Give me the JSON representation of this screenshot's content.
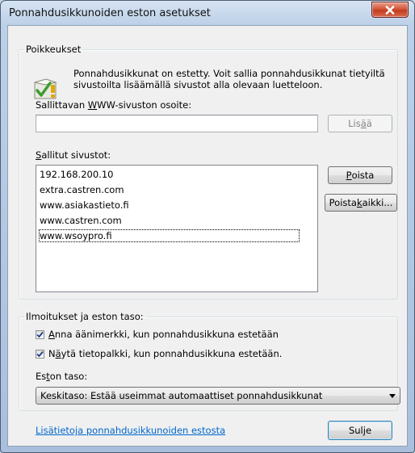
{
  "window": {
    "title": "Ponnahdusikkunoiden eston asetukset"
  },
  "exceptions": {
    "legend": "Poikkeukset",
    "info_line1": "Ponnahdusikkunat on estetty. Voit sallia ponnahdusikkunat tietyiltä",
    "info_line2": "sivustoilta lisäämällä sivustot alla olevaan luetteloon.",
    "address_label_pre": "Sallittavan ",
    "address_label_key": "W",
    "address_label_post": "WW-sivuston osoite:",
    "address_value": "",
    "add_label_pre": "Lis",
    "add_label_key": "ä",
    "add_label_post": "ä",
    "allowed_label_pre": "",
    "allowed_label_key": "S",
    "allowed_label_post": "allitut sivustot:",
    "allowed_sites": [
      "192.168.200.10",
      "extra.castren.com",
      "www.asiakastieto.fi",
      "www.castren.com",
      "www.wsoypro.fi"
    ],
    "remove_label_key": "P",
    "remove_label_post": "oista",
    "remove_all_label_pre": "Poista ",
    "remove_all_label_key": "k",
    "remove_all_label_post": "aikki..."
  },
  "notifications": {
    "legend": "Ilmoitukset ja eston taso:",
    "sound_label_key": "A",
    "sound_label_post": "nna äänimerkki, kun ponnahdusikkuna estetään",
    "sound_checked": true,
    "infobar_label_pre": "N",
    "infobar_label_key": "ä",
    "infobar_label_post": "ytä tietopalkki, kun ponnahdusikkuna estetään.",
    "infobar_checked": true,
    "level_label_pre": "Es",
    "level_label_key": "t",
    "level_label_post": "on taso:",
    "level_value": "Keskitaso: Estää useimmat automaattiset ponnahdusikkunat"
  },
  "footer": {
    "learn_more": "Lisätietoja ponnahdusikkunoiden estosta",
    "close_label": "Sulje"
  }
}
